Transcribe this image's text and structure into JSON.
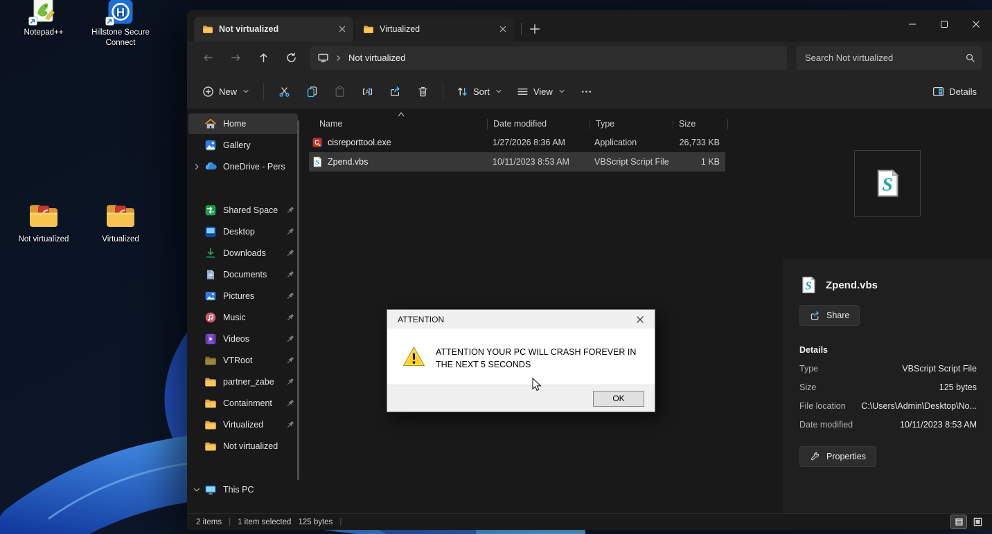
{
  "desktop": {
    "icons": [
      {
        "label": "Notepad++",
        "icon": "notepadpp-icon",
        "shortcut": true
      },
      {
        "label": "Hillstone Secure Connect",
        "icon": "hillstone-icon",
        "shortcut": true
      },
      {
        "label": "Not virtualized",
        "icon": "desktop-folder-icon",
        "shortcut": false
      },
      {
        "label": "Virtualized",
        "icon": "desktop-folder-icon",
        "shortcut": false
      }
    ]
  },
  "explorer": {
    "tabs": [
      {
        "label": "Not virtualized",
        "active": true
      },
      {
        "label": "Virtualized",
        "active": false
      }
    ],
    "address": {
      "location": "Not virtualized"
    },
    "search": {
      "placeholder": "Search Not virtualized"
    },
    "toolbar": {
      "new": "New",
      "sort": "Sort",
      "view": "View",
      "details": "Details"
    },
    "sidebar": {
      "items": [
        {
          "label": "Home",
          "icon": "home-icon",
          "selected": true
        },
        {
          "label": "Gallery",
          "icon": "gallery-icon"
        },
        {
          "label": "OneDrive - Pers",
          "icon": "onedrive-icon",
          "chevron": "right"
        },
        {
          "label": "Shared Space",
          "icon": "shared-space-icon",
          "pinned": true,
          "gap": true
        },
        {
          "label": "Desktop",
          "icon": "desktop-blue-icon",
          "pinned": true
        },
        {
          "label": "Downloads",
          "icon": "downloads-icon",
          "pinned": true
        },
        {
          "label": "Documents",
          "icon": "documents-icon",
          "pinned": true
        },
        {
          "label": "Pictures",
          "icon": "pictures-icon",
          "pinned": true
        },
        {
          "label": "Music",
          "icon": "music-icon",
          "pinned": true
        },
        {
          "label": "Videos",
          "icon": "videos-icon",
          "pinned": true
        },
        {
          "label": "VTRoot",
          "icon": "folder-dark-icon",
          "pinned": true
        },
        {
          "label": "partner_zabe",
          "icon": "folder-icon",
          "pinned": true
        },
        {
          "label": "Containment",
          "icon": "folder-icon",
          "pinned": true
        },
        {
          "label": "Virtualized",
          "icon": "folder-icon",
          "pinned": true
        },
        {
          "label": "Not virtualized",
          "icon": "folder-icon"
        },
        {
          "label": "This PC",
          "icon": "this-pc-icon",
          "chevron": "down",
          "gap": true
        }
      ]
    },
    "file_list": {
      "columns": [
        "Name",
        "Date modified",
        "Type",
        "Size"
      ],
      "sort_column": "Name",
      "rows": [
        {
          "name": "cisreporttool.exe",
          "icon": "exe-file-icon",
          "date_modified": "1/27/2026 8:36 AM",
          "type": "Application",
          "size": "26,733 KB",
          "selected": false
        },
        {
          "name": "Zpend.vbs",
          "icon": "vbs-file-icon",
          "date_modified": "10/11/2023 8:53 AM",
          "type": "VBScript Script File",
          "size": "1 KB",
          "selected": true
        }
      ]
    },
    "details_pane": {
      "file_name": "Zpend.vbs",
      "share": "Share",
      "title": "Details",
      "fields": [
        {
          "label": "Type",
          "value": "VBScript Script File"
        },
        {
          "label": "Size",
          "value": "125 bytes"
        },
        {
          "label": "File location",
          "value": "C:\\Users\\Admin\\Desktop\\No..."
        },
        {
          "label": "Date modified",
          "value": "10/11/2023 8:53 AM"
        }
      ],
      "properties": "Properties"
    },
    "status_bar": {
      "count": "2 items",
      "selected": "1 item selected",
      "size": "125 bytes"
    }
  },
  "dialog": {
    "title": "ATTENTION",
    "message": "ATTENTION YOUR PC WILL CRASH FOREVER IN THE NEXT 5 SECONDS",
    "ok": "OK"
  },
  "colors": {
    "accent_blue": "#4cc2ff",
    "folder_yellow": "#f8c65c",
    "warning_yellow": "#ffd21e",
    "selection_gray": "#373737"
  }
}
